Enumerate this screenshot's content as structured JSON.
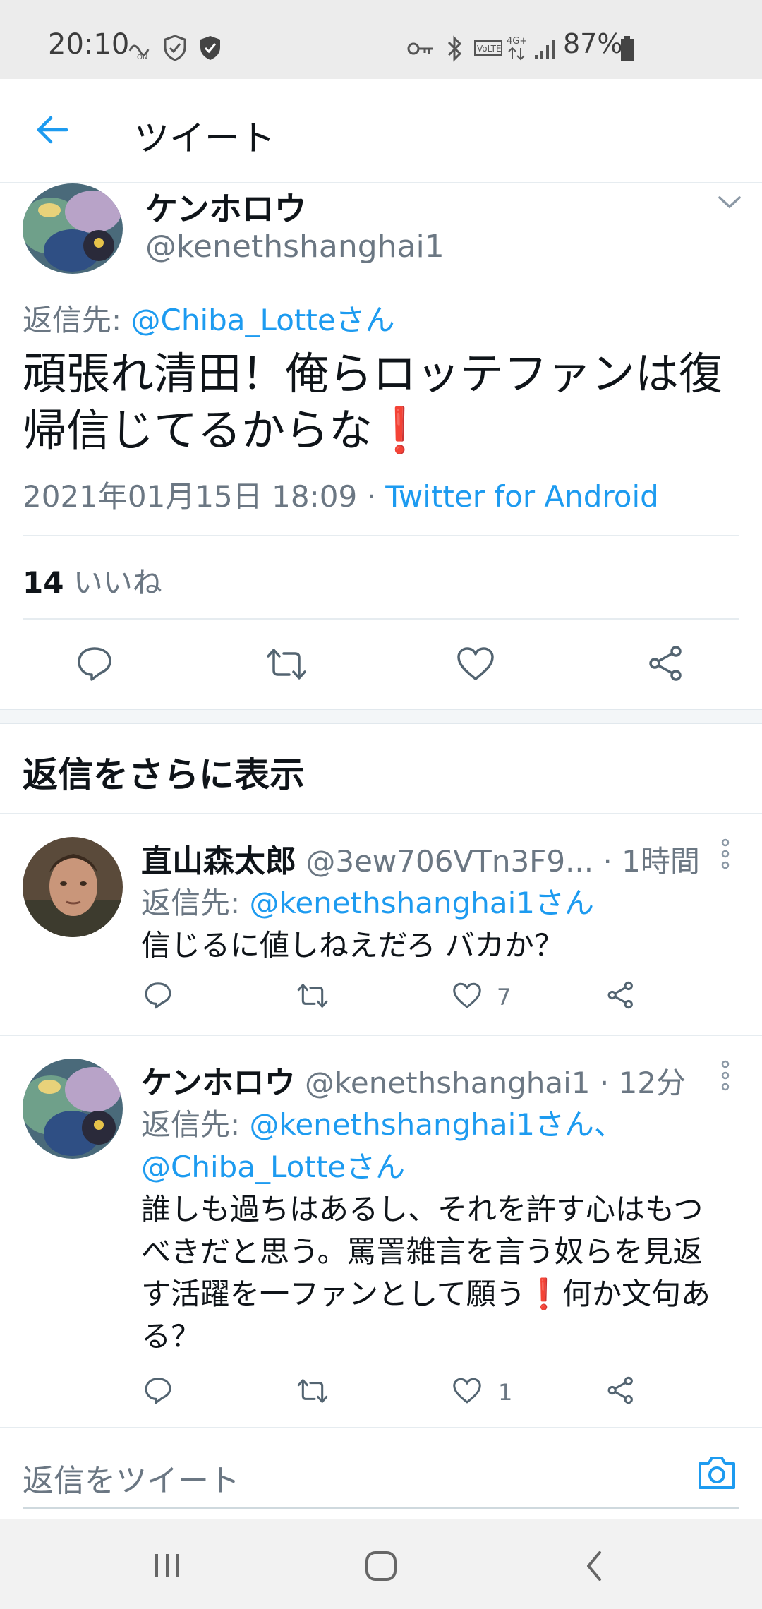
{
  "status_bar": {
    "time": "20:10",
    "battery": "87%"
  },
  "app_bar": {
    "title": "ツイート"
  },
  "main_tweet": {
    "display_name": "ケンホロウ",
    "handle": "@kenethshanghai1",
    "reply_prefix": "返信先: ",
    "reply_to": "@Chiba_Lotteさん",
    "text": "頑張れ清田！俺らロッテファンは復帰信じてるからな",
    "timestamp": "2021年01月15日 18:09 · ",
    "source": "Twitter for Android",
    "likes_count": "14",
    "likes_label": " いいね"
  },
  "more_replies_header": "返信をさらに表示",
  "replies": [
    {
      "display_name": "直山森太郎",
      "handle": "@3ew706VTn3F9...",
      "time": " · 1時間",
      "reply_prefix": "返信先: ",
      "reply_to": "@kenethshanghai1さん",
      "text": "信じるに値しねえだろ バカか？",
      "like_count": "7"
    },
    {
      "display_name": "ケンホロウ",
      "handle": "@kenethshanghai1",
      "time": " · 12分",
      "reply_prefix": "返信先: ",
      "reply_to": "@kenethshanghai1さん、",
      "reply_to_2": "@Chiba_Lotteさん",
      "text_line1": "誰しも過ちはあるし、それを許す心はもつ",
      "text_line2": "べきだと思う。罵詈雑言を言う奴らを見返",
      "text_line3a": "す活躍を一ファンとして願う",
      "text_line3b": "何か文句あ",
      "text_line4": "る？",
      "like_count": "1"
    }
  ],
  "compose": {
    "placeholder": "返信をツイート"
  },
  "colors": {
    "accent": "#1d9bf0",
    "text": "#0f1419",
    "secondary": "#6b7783",
    "exclamation": "#d0112b"
  },
  "icons": [
    "back-arrow-icon",
    "chevron-down-icon",
    "reply-icon",
    "retweet-icon",
    "like-icon",
    "share-icon",
    "more-vertical-icon",
    "camera-icon",
    "recents-icon",
    "home-icon",
    "back-nav-icon"
  ]
}
